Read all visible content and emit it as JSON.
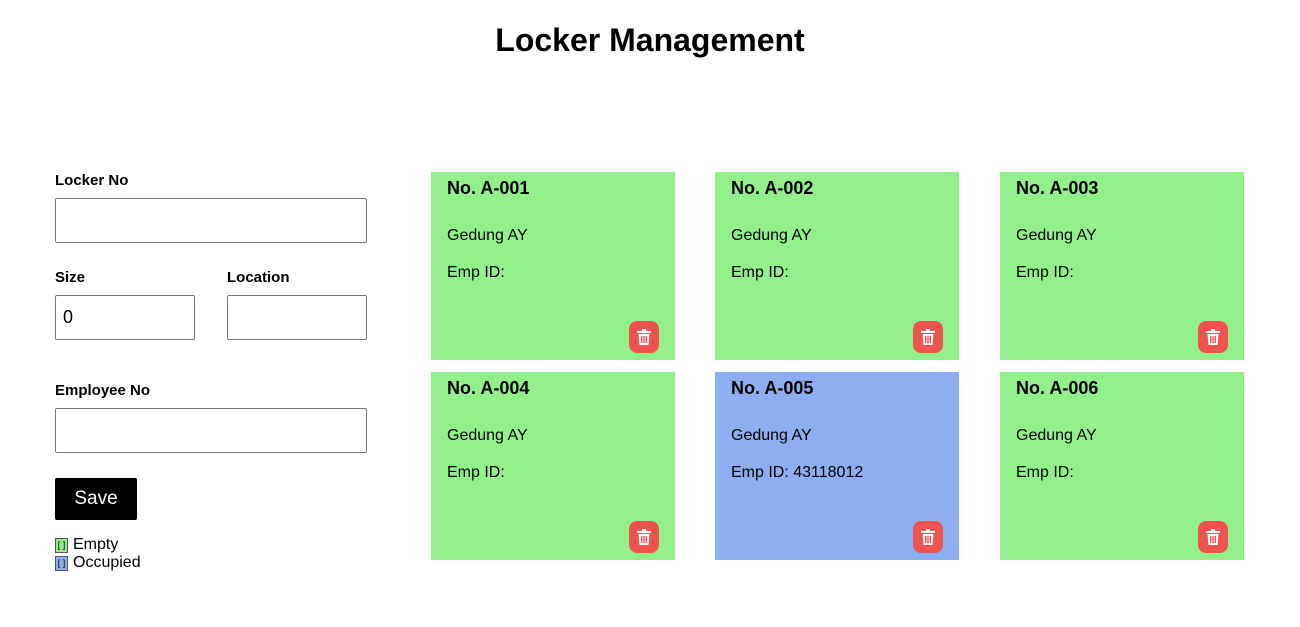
{
  "page": {
    "title": "Locker Management"
  },
  "form": {
    "locker_no_label": "Locker No",
    "locker_no_value": "",
    "size_label": "Size",
    "size_value": "0",
    "location_label": "Location",
    "location_value": "",
    "employee_no_label": "Employee No",
    "employee_no_value": "",
    "save_label": "Save"
  },
  "legend": {
    "empty_label": "Empty",
    "occupied_label": "Occupied",
    "empty_color": "#93ef8c",
    "occupied_color": "#8daeef"
  },
  "colors": {
    "delete": "#ef5350"
  },
  "lockers": [
    {
      "no": "No. A-001",
      "location": "Gedung AY",
      "emp": "Emp ID:",
      "status": "empty",
      "icon": "trash-icon"
    },
    {
      "no": "No. A-002",
      "location": "Gedung AY",
      "emp": "Emp ID:",
      "status": "empty",
      "icon": "trash-icon"
    },
    {
      "no": "No. A-003",
      "location": "Gedung AY",
      "emp": "Emp ID:",
      "status": "empty",
      "icon": "trash-icon"
    },
    {
      "no": "No. A-004",
      "location": "Gedung AY",
      "emp": "Emp ID:",
      "status": "empty",
      "icon": "trash-icon"
    },
    {
      "no": "No. A-005",
      "location": "Gedung AY",
      "emp": "Emp ID: 43118012",
      "status": "occupied",
      "icon": "trash-icon"
    },
    {
      "no": "No. A-006",
      "location": "Gedung AY",
      "emp": "Emp ID:",
      "status": "empty",
      "icon": "trash-icon"
    }
  ]
}
